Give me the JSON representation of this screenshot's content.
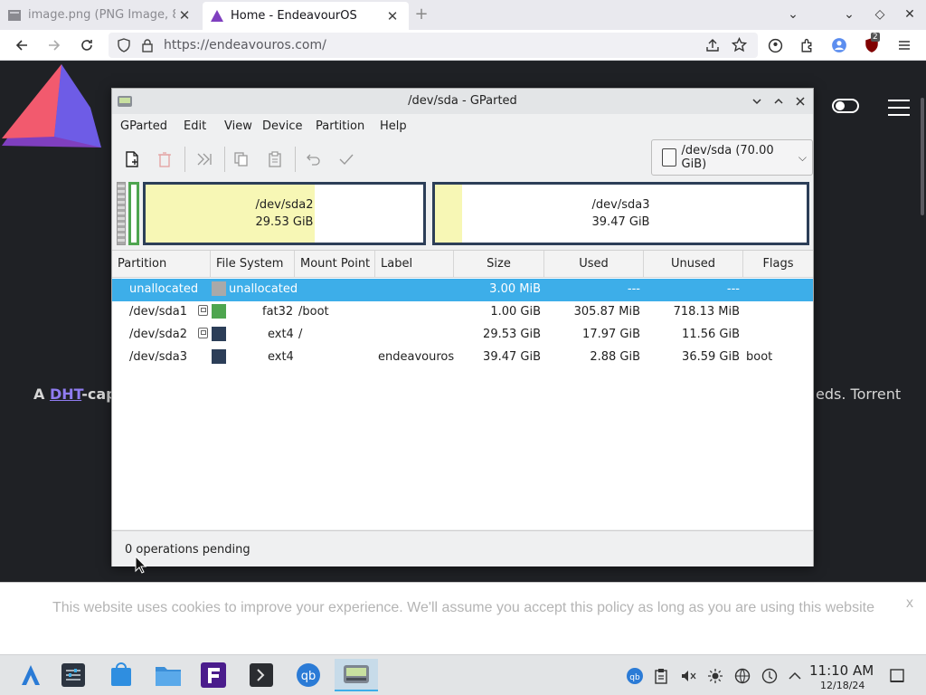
{
  "browser": {
    "tabs": [
      {
        "title": "image.png (PNG Image, 8…",
        "icon": "image-file-icon",
        "active": false
      },
      {
        "title": "Home - EndeavourOS",
        "icon": "endeavouros-icon",
        "active": true
      }
    ],
    "url": "https://endeavouros.com/",
    "extension_badge": "2"
  },
  "webpage": {
    "dht_prefix": "A ",
    "dht_link": "DHT",
    "dht_suffix": "-cap",
    "right_fragment": "eds. Torrent",
    "cookie_notice": "This website uses cookies to improve your experience. We'll assume you accept this policy as long as you are using this website",
    "cookie_close": "x"
  },
  "gparted": {
    "title": "/dev/sda - GParted",
    "menus": [
      "GParted",
      "Edit",
      "View",
      "Device",
      "Partition",
      "Help"
    ],
    "device": "/dev/sda (70.00 GiB)",
    "graphic": {
      "sda2": {
        "name": "/dev/sda2",
        "size": "29.53 GiB",
        "used_fraction": 0.61
      },
      "sda3": {
        "name": "/dev/sda3",
        "size": "39.47 GiB",
        "used_fraction": 0.073
      }
    },
    "columns": [
      "Partition",
      "File System",
      "Mount Point",
      "Label",
      "Size",
      "Used",
      "Unused",
      "Flags"
    ],
    "rows": [
      {
        "partition": "unallocated",
        "filesystem": "unallocated",
        "mount": "",
        "label": "",
        "size": "3.00 MiB",
        "used": "---",
        "unused": "---",
        "flags": "",
        "color": "#a9a9a9",
        "locked": false,
        "selected": true
      },
      {
        "partition": "/dev/sda1",
        "filesystem": "fat32",
        "mount": "/boot",
        "label": "",
        "size": "1.00 GiB",
        "used": "305.87 MiB",
        "unused": "718.13 MiB",
        "flags": "",
        "color": "#4ea54f",
        "locked": true,
        "selected": false
      },
      {
        "partition": "/dev/sda2",
        "filesystem": "ext4",
        "mount": "/",
        "label": "",
        "size": "29.53 GiB",
        "used": "17.97 GiB",
        "unused": "11.56 GiB",
        "flags": "",
        "color": "#2c3e58",
        "locked": true,
        "selected": false
      },
      {
        "partition": "/dev/sda3",
        "filesystem": "ext4",
        "mount": "",
        "label": "endeavouros",
        "size": "39.47 GiB",
        "used": "2.88 GiB",
        "unused": "36.59 GiB",
        "flags": "boot",
        "color": "#2c3e58",
        "locked": false,
        "selected": false
      }
    ],
    "status": "0 operations pending"
  },
  "taskbar": {
    "time": "11:10 AM",
    "date": "12/18/24"
  }
}
